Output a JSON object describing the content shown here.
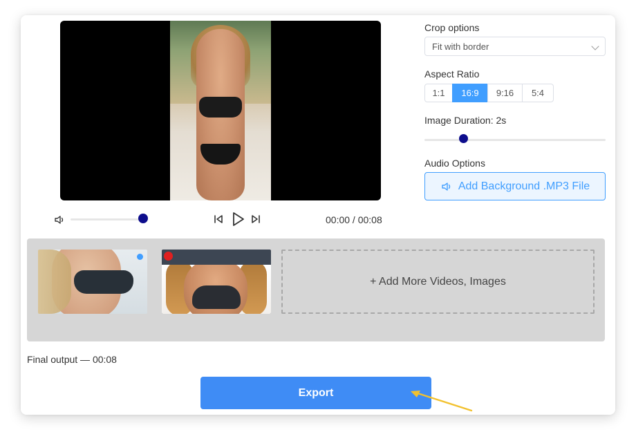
{
  "player": {
    "time": "00:00 / 00:08",
    "volume_level": 0.95
  },
  "crop": {
    "label": "Crop options",
    "selected": "Fit with border"
  },
  "aspect": {
    "label": "Aspect Ratio",
    "options": [
      "1:1",
      "16:9",
      "9:16",
      "5:4"
    ],
    "selected": "16:9"
  },
  "duration": {
    "label": "Image Duration: 2s",
    "level": 0.2
  },
  "audio": {
    "label": "Audio Options",
    "button": "Add Background .MP3 File"
  },
  "tray": {
    "add_more": "+ Add More Videos, Images"
  },
  "final_output": "Final output — 00:08",
  "export": "Export",
  "colors": {
    "accent": "#409eff",
    "export": "#3f8cf5",
    "knob": "#0d0d8c",
    "arrow": "#f2c12e"
  },
  "icons": [
    "volume-icon",
    "skip-back-icon",
    "play-icon",
    "skip-forward-icon",
    "chevron-down-icon",
    "speaker-icon",
    "plus-icon"
  ]
}
